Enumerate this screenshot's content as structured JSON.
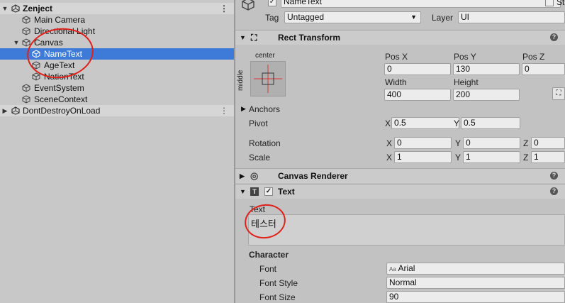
{
  "hierarchy": {
    "scene": "Zenject",
    "items": [
      "Main Camera",
      "Directional Light",
      "Canvas",
      "NameText",
      "AgeText",
      "NationText",
      "EventSystem",
      "SceneContext"
    ],
    "dont_destroy": "DontDestroyOnLoad"
  },
  "inspector": {
    "object_name": "NameText",
    "static_label": "St",
    "tag_label": "Tag",
    "tag_value": "Untagged",
    "layer_label": "Layer",
    "layer_value": "UI",
    "rect_transform": {
      "title": "Rect Transform",
      "anchor_h": "center",
      "anchor_v": "middle",
      "pos_x_label": "Pos X",
      "pos_y_label": "Pos Y",
      "pos_z_label": "Pos Z",
      "pos_x": "0",
      "pos_y": "130",
      "pos_z": "0",
      "width_label": "Width",
      "height_label": "Height",
      "width": "400",
      "height": "200",
      "anchors_label": "Anchors",
      "pivot_label": "Pivot",
      "pivot_x": "0.5",
      "pivot_y": "0.5",
      "rotation_label": "Rotation",
      "rot_x": "0",
      "rot_y": "0",
      "rot_z": "0",
      "scale_label": "Scale",
      "scale_x": "1",
      "scale_y": "1",
      "scale_z": "1",
      "x": "X",
      "y": "Y",
      "z": "Z"
    },
    "canvas_renderer": {
      "title": "Canvas Renderer"
    },
    "text_component": {
      "title": "Text",
      "text_label": "Text",
      "text_value": "테스터",
      "character_label": "Character",
      "font_label": "Font",
      "font_value": "Arial",
      "font_prefix": "Aa",
      "font_style_label": "Font Style",
      "font_style_value": "Normal",
      "font_size_label": "Font Size",
      "font_size_value": "90"
    }
  },
  "colors": {
    "selection": "#3e7bd8",
    "annotation": "#e0201a"
  }
}
